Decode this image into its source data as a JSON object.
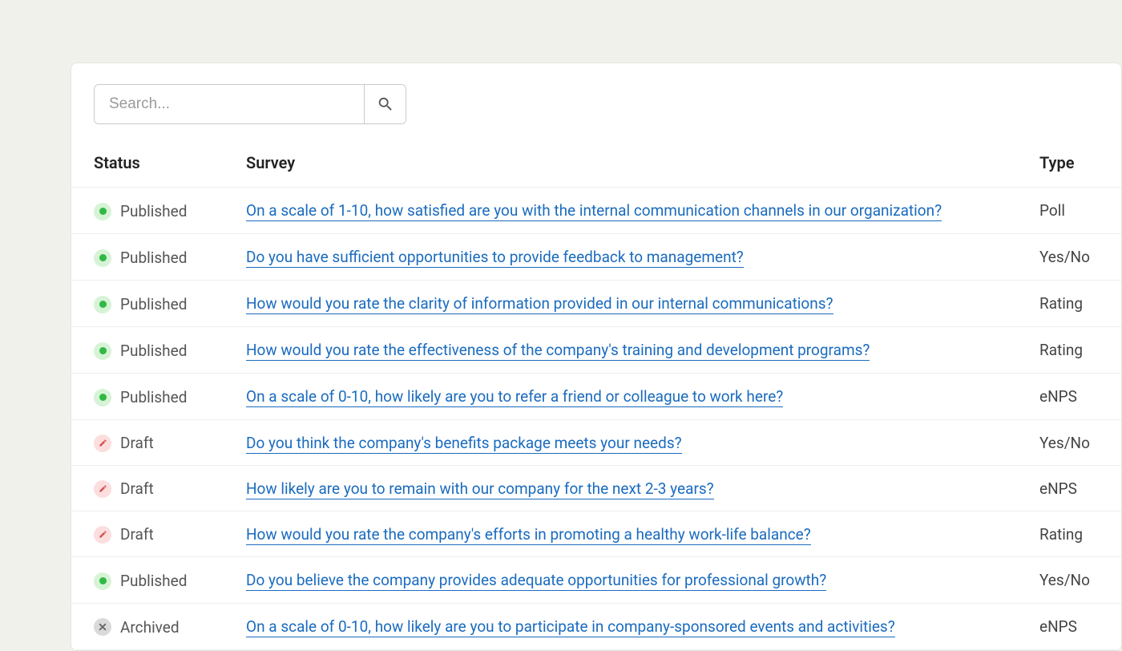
{
  "search": {
    "placeholder": "Search..."
  },
  "headers": {
    "status": "Status",
    "survey": "Survey",
    "type": "Type"
  },
  "rows": [
    {
      "status": "Published",
      "statusKind": "published",
      "survey": "On a scale of 1-10, how satisfied are you with the internal communication channels in our organization?",
      "type": "Poll"
    },
    {
      "status": "Published",
      "statusKind": "published",
      "survey": "Do you have sufficient opportunities to provide feedback to management?",
      "type": "Yes/No"
    },
    {
      "status": "Published",
      "statusKind": "published",
      "survey": "How would you rate the clarity of information provided in our internal communications?",
      "type": "Rating"
    },
    {
      "status": "Published",
      "statusKind": "published",
      "survey": "How would you rate the effectiveness of the company's training and development programs?",
      "type": "Rating"
    },
    {
      "status": "Published",
      "statusKind": "published",
      "survey": "On a scale of 0-10, how likely are you to refer a friend or colleague to work here?",
      "type": "eNPS"
    },
    {
      "status": "Draft",
      "statusKind": "draft",
      "survey": "Do you think the company's benefits package meets your needs?",
      "type": "Yes/No"
    },
    {
      "status": "Draft",
      "statusKind": "draft",
      "survey": "How likely are you to remain with our company for the next 2-3 years?",
      "type": "eNPS"
    },
    {
      "status": "Draft",
      "statusKind": "draft",
      "survey": "How would you rate the company's efforts in promoting a healthy work-life balance?",
      "type": "Rating"
    },
    {
      "status": "Published",
      "statusKind": "published",
      "survey": "Do you believe the company provides adequate opportunities for professional growth?",
      "type": "Yes/No"
    },
    {
      "status": "Archived",
      "statusKind": "archived",
      "survey": "On a scale of 0-10, how likely are you to participate in company-sponsored events and activities?",
      "type": "eNPS"
    }
  ]
}
